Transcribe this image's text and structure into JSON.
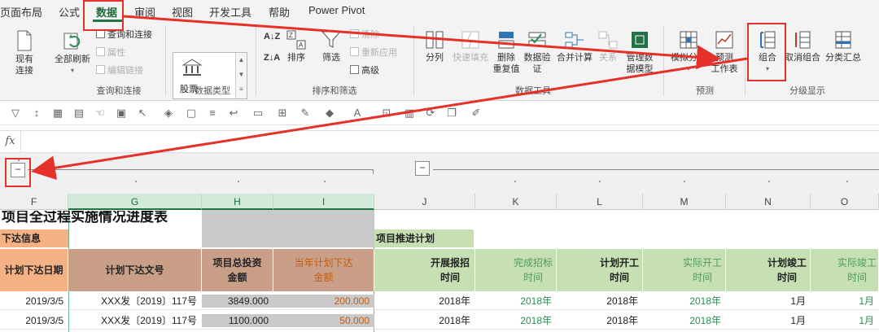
{
  "tabs": [
    {
      "label": "页面布局",
      "active": false
    },
    {
      "label": "公式",
      "active": false
    },
    {
      "label": "数据",
      "active": true
    },
    {
      "label": "审阅",
      "active": false
    },
    {
      "label": "视图",
      "active": false
    },
    {
      "label": "开发工具",
      "active": false
    },
    {
      "label": "帮助",
      "active": false
    },
    {
      "label": "Power Pivot",
      "active": false
    }
  ],
  "ribbon": {
    "existing_connections": "现有\n连接",
    "refresh_all": "全部刷新",
    "queries_connections": "查询和连接",
    "properties": "属性",
    "edit_links": "编辑链接",
    "group_queries": "查询和连接",
    "stocks": "股票",
    "group_datatypes": "数据类型",
    "sort": "排序",
    "filter": "筛选",
    "clear": "清除",
    "reapply": "重新应用",
    "advanced": "高级",
    "group_sortfilter": "排序和筛选",
    "text_to_columns": "分列",
    "flash_fill": "快速填充",
    "remove_duplicates": "删除\n重复值",
    "data_validation": "数据验\n证",
    "consolidate": "合并计算",
    "relationships": "关系",
    "manage_model": "管理数\n据模型",
    "group_datatools": "数据工具",
    "what_if": "模拟分析",
    "forecast_sheet": "预测\n工作表",
    "group_forecast": "预测",
    "group_button": "组合",
    "ungroup": "取消组合",
    "subtotal": "分类汇总",
    "group_outline": "分级显示"
  },
  "formula_bar": {
    "fx": "fx",
    "value": ""
  },
  "outline": {
    "btn1": "−",
    "btn2": "−"
  },
  "columns": [
    "F",
    "G",
    "H",
    "I",
    "J",
    "K",
    "L",
    "M",
    "N",
    "O"
  ],
  "sheet": {
    "title": "项目全过程实施情况进度表",
    "section_left": "下达信息",
    "section_right": "项目推进计划",
    "headers": {
      "F": "计划下达日期",
      "G": "计划下达文号",
      "H": "项目总投资\n金额",
      "I": "当年计划下达\n金额",
      "J": "开展报招\n时间",
      "K": "完成招标\n时间",
      "L": "计划开工\n时间",
      "M": "实际开工\n时间",
      "N": "计划竣工\n时间",
      "O": "实际竣工\n时间"
    },
    "rows": [
      {
        "F": "2019/3/5",
        "G": "XXX发〔2019〕117号",
        "H": "3849.000",
        "I": "200.000",
        "J": "2018年",
        "K": "2018年",
        "L": "2018年",
        "M": "2018年",
        "N": "1月",
        "O": "1月"
      },
      {
        "F": "2019/3/5",
        "G": "XXX发〔2019〕117号",
        "H": "1100.000",
        "I": "50.000",
        "J": "2018年",
        "K": "2018年",
        "L": "2018年",
        "M": "2018年",
        "N": "1月",
        "O": "1月"
      }
    ]
  },
  "colors": {
    "accent": "#217346",
    "annotation": "#e5312a",
    "orange_hdr": "#f4b183",
    "brown_hdr": "#c9a087",
    "green_hdr": "#c6e0b4",
    "gray_hdr": "#bfbfbf"
  }
}
